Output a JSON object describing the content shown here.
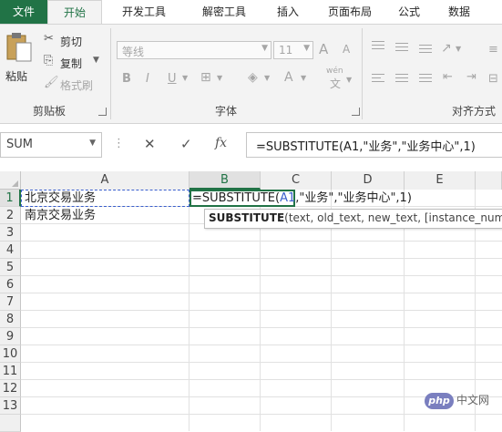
{
  "ribbon_tabs": [
    "文件",
    "开始",
    "开发工具",
    "解密工具",
    "插入",
    "页面布局",
    "公式",
    "数据"
  ],
  "clipboard": {
    "paste": "粘贴",
    "cut": "剪切",
    "copy": "复制",
    "format_painter": "格式刷",
    "group_label": "剪贴板"
  },
  "font": {
    "name": "等线",
    "size": "11",
    "grow": "A",
    "shrink": "A",
    "bold": "B",
    "italic": "I",
    "underline": "U",
    "font_color": "A",
    "phonetic": "wén",
    "group_label": "字体"
  },
  "alignment": {
    "group_label": "对齐方式"
  },
  "formula_bar": {
    "name_box": "SUM",
    "cancel": "✕",
    "enter": "✓",
    "fx": "fx",
    "formula": "=SUBSTITUTE(A1,\"业务\",\"业务中心\",1)"
  },
  "columns": [
    "A",
    "B",
    "C",
    "D",
    "E"
  ],
  "rows": [
    "1",
    "2",
    "3",
    "4",
    "5",
    "6",
    "7",
    "8",
    "9",
    "10",
    "11",
    "12",
    "13"
  ],
  "cells": {
    "A1": "北京交易业务",
    "A2": "南京交易业务"
  },
  "edit": {
    "prefix": "=SUBSTITUTE(",
    "ref": "A1",
    "rest": ",\"业务\",\"业务中心\",1)"
  },
  "tooltip": {
    "func": "SUBSTITUTE",
    "args": "(text, old_text, new_text, [instance_num"
  },
  "watermark": {
    "logo": "php",
    "text": "中文网"
  },
  "colors": {
    "excel_green": "#217346",
    "ref_blue": "#3a5fcd"
  }
}
